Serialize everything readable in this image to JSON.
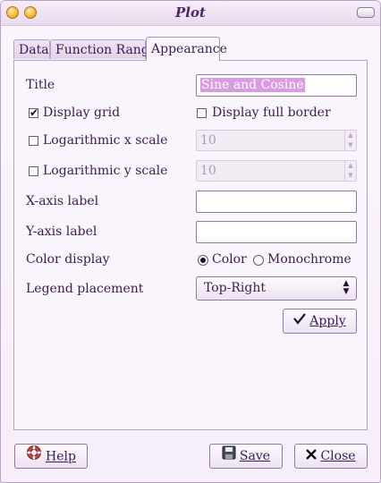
{
  "window": {
    "title": "Plot"
  },
  "tabs": [
    {
      "label": "Data"
    },
    {
      "label": "Function Range"
    },
    {
      "label": "Appearance"
    }
  ],
  "appearance": {
    "title_label": "Title",
    "title_value": "Sine and Cosine",
    "display_grid": {
      "label": "Display grid",
      "checked": true
    },
    "display_full_border": {
      "label": "Display full border",
      "checked": false
    },
    "log_x": {
      "label": "Logarithmic x scale",
      "checked": false,
      "value": "10"
    },
    "log_y": {
      "label": "Logarithmic y scale",
      "checked": false,
      "value": "10"
    },
    "x_axis_label": {
      "label": "X-axis label",
      "value": ""
    },
    "y_axis_label": {
      "label": "Y-axis label",
      "value": ""
    },
    "color_display": {
      "label": "Color display",
      "options": [
        "Color",
        "Monochrome"
      ],
      "selected": "Color"
    },
    "legend_placement": {
      "label": "Legend placement",
      "value": "Top-Right"
    },
    "apply_label": "Apply"
  },
  "footer": {
    "help_label": "Help",
    "save_label": "Save",
    "close_label": "Close"
  },
  "icons": {
    "check": "✔",
    "apply": "check-icon",
    "help": "lifebuoy-icon",
    "save": "floppy-disk-icon",
    "close": "x-icon"
  }
}
